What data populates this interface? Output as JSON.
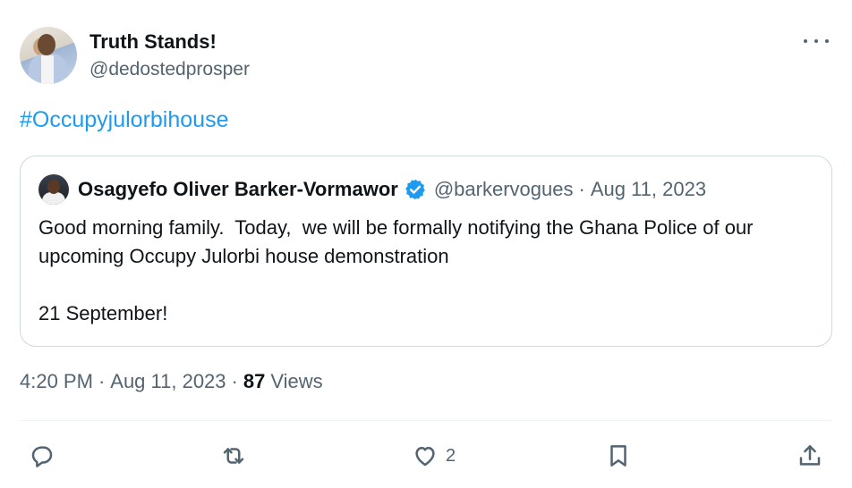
{
  "author": {
    "display_name": "Truth Stands!",
    "handle": "@dedostedprosper"
  },
  "more_icon": "more-horizontal-icon",
  "tweet": {
    "hashtag": "#Occupyjulorbihouse"
  },
  "quoted_tweet": {
    "display_name": "Osagyefo Oliver Barker-Vormawor",
    "verified": true,
    "handle": "@barkervogues",
    "separator": "·",
    "date": "Aug 11, 2023",
    "text": "Good morning family.  Today,  we will be formally notifying the Ghana Police of our upcoming Occupy Julorbi house demonstration\n\n21 September!"
  },
  "meta": {
    "time": "4:20 PM",
    "separator": "·",
    "date": "Aug 11, 2023",
    "separator2": "·",
    "views_count": "87",
    "views_label": "Views"
  },
  "actions": {
    "reply_icon": "reply-icon",
    "repost_icon": "repost-icon",
    "like_icon": "like-icon",
    "like_count": "2",
    "bookmark_icon": "bookmark-icon",
    "share_icon": "share-icon"
  },
  "colors": {
    "accent": "#1d9bf0",
    "text_primary": "#0f1419",
    "text_secondary": "#536471",
    "border": "#cfd9de"
  }
}
